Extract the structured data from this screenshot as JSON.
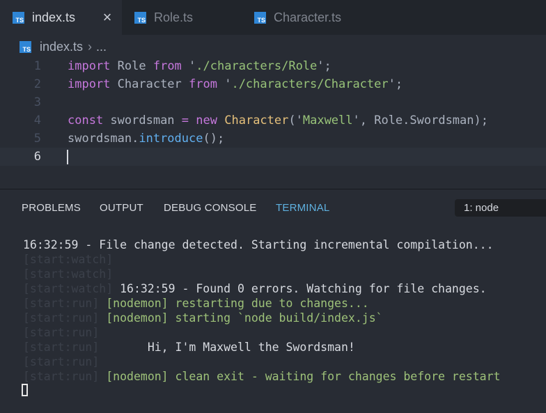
{
  "tabs": [
    {
      "label": "index.ts",
      "active": true,
      "icon": "typescript-file-icon"
    },
    {
      "label": "Role.ts",
      "active": false,
      "icon": "typescript-file-icon"
    },
    {
      "label": "Character.ts",
      "active": false,
      "icon": "typescript-file-icon"
    }
  ],
  "close_icon": "×",
  "breadcrumb": {
    "file": "index.ts",
    "separator": "›",
    "more": "..."
  },
  "editor": {
    "lines": [
      {
        "number": "1",
        "tokens": [
          {
            "text": "import",
            "kind": "kw"
          },
          {
            "text": " Role ",
            "kind": "plain"
          },
          {
            "text": "from",
            "kind": "kw"
          },
          {
            "text": " '",
            "kind": "plain"
          },
          {
            "text": "./characters/Role",
            "kind": "str"
          },
          {
            "text": "';",
            "kind": "plain"
          }
        ]
      },
      {
        "number": "2",
        "tokens": [
          {
            "text": "import",
            "kind": "kw"
          },
          {
            "text": " Character ",
            "kind": "plain"
          },
          {
            "text": "from",
            "kind": "kw"
          },
          {
            "text": " '",
            "kind": "plain"
          },
          {
            "text": "./characters/Character",
            "kind": "str"
          },
          {
            "text": "';",
            "kind": "plain"
          }
        ]
      },
      {
        "number": "3",
        "tokens": []
      },
      {
        "number": "4",
        "tokens": [
          {
            "text": "const",
            "kind": "kw"
          },
          {
            "text": " swordsman ",
            "kind": "plain"
          },
          {
            "text": "=",
            "kind": "kw"
          },
          {
            "text": " ",
            "kind": "plain"
          },
          {
            "text": "new",
            "kind": "kw"
          },
          {
            "text": " ",
            "kind": "plain"
          },
          {
            "text": "Character",
            "kind": "cls"
          },
          {
            "text": "('",
            "kind": "plain"
          },
          {
            "text": "Maxwell",
            "kind": "str"
          },
          {
            "text": "', Role.Swordsman);",
            "kind": "plain"
          }
        ]
      },
      {
        "number": "5",
        "tokens": [
          {
            "text": "swordsman.",
            "kind": "plain"
          },
          {
            "text": "introduce",
            "kind": "fn"
          },
          {
            "text": "();",
            "kind": "plain"
          }
        ]
      },
      {
        "number": "6",
        "tokens": [],
        "current": true
      }
    ]
  },
  "panel": {
    "tabs": [
      {
        "label": "PROBLEMS",
        "active": false
      },
      {
        "label": "OUTPUT",
        "active": false
      },
      {
        "label": "DEBUG CONSOLE",
        "active": false
      },
      {
        "label": "TERMINAL",
        "active": true
      }
    ],
    "terminal_select": "1: node"
  },
  "terminal": {
    "lines": [
      [
        {
          "text": "16:32:59 - File change detected. Starting incremental compilation...",
          "kind": "plain"
        }
      ],
      [
        {
          "text": "[start:watch]",
          "kind": "dim"
        }
      ],
      [
        {
          "text": "[start:watch]",
          "kind": "dim"
        }
      ],
      [
        {
          "text": "[start:watch]",
          "kind": "dim"
        },
        {
          "text": " 16:32:59 - Found 0 errors. Watching for file changes.",
          "kind": "plain"
        }
      ],
      [
        {
          "text": "[start:run]",
          "kind": "dim"
        },
        {
          "text": " [nodemon] restarting due to changes...",
          "kind": "green"
        }
      ],
      [
        {
          "text": "[start:run]",
          "kind": "dim"
        },
        {
          "text": " [nodemon] starting `node build/index.js`",
          "kind": "green"
        }
      ],
      [
        {
          "text": "[start:run]",
          "kind": "dim"
        }
      ],
      [
        {
          "text": "[start:run]",
          "kind": "dim"
        },
        {
          "text": "       Hi, I'm Maxwell the Swordsman!",
          "kind": "plain"
        }
      ],
      [
        {
          "text": "[start:run]",
          "kind": "dim"
        }
      ],
      [
        {
          "text": "[start:run]",
          "kind": "dim"
        },
        {
          "text": " [nodemon] clean exit - waiting for changes before restart",
          "kind": "green"
        }
      ]
    ]
  },
  "colors": {
    "background": "#282c34",
    "tabbar": "#21252b",
    "keyword": "#c678dd",
    "string": "#98c379",
    "class": "#e5c07b",
    "function": "#61afef",
    "terminal_active_tab": "#5fb1e0",
    "nodemon_green": "#9ec279"
  }
}
